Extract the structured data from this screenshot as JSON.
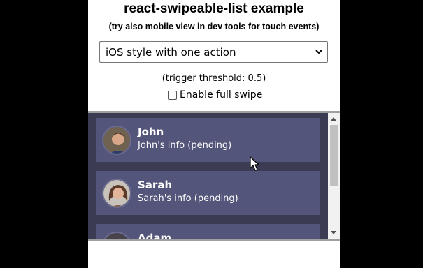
{
  "page": {
    "title": "react-swipeable-list example",
    "subtitle": "(try also mobile view in dev tools for touch events)"
  },
  "controls": {
    "mode_select": {
      "selected": "iOS style with one action"
    },
    "threshold_text": "(trigger threshold: 0.5)",
    "full_swipe": {
      "label": "Enable full swipe",
      "checked": false
    }
  },
  "list": {
    "items": [
      {
        "name": "John",
        "info": "John's info (pending)",
        "avatar": "john-avatar-icon"
      },
      {
        "name": "Sarah",
        "info": "Sarah's info (pending)",
        "avatar": "sarah-avatar-icon"
      },
      {
        "name": "Adam",
        "info": "",
        "avatar": "adam-avatar-icon"
      }
    ]
  },
  "colors": {
    "list_bg": "#3b3b54",
    "item_bg": "#54557a",
    "text": "#ffffff"
  }
}
